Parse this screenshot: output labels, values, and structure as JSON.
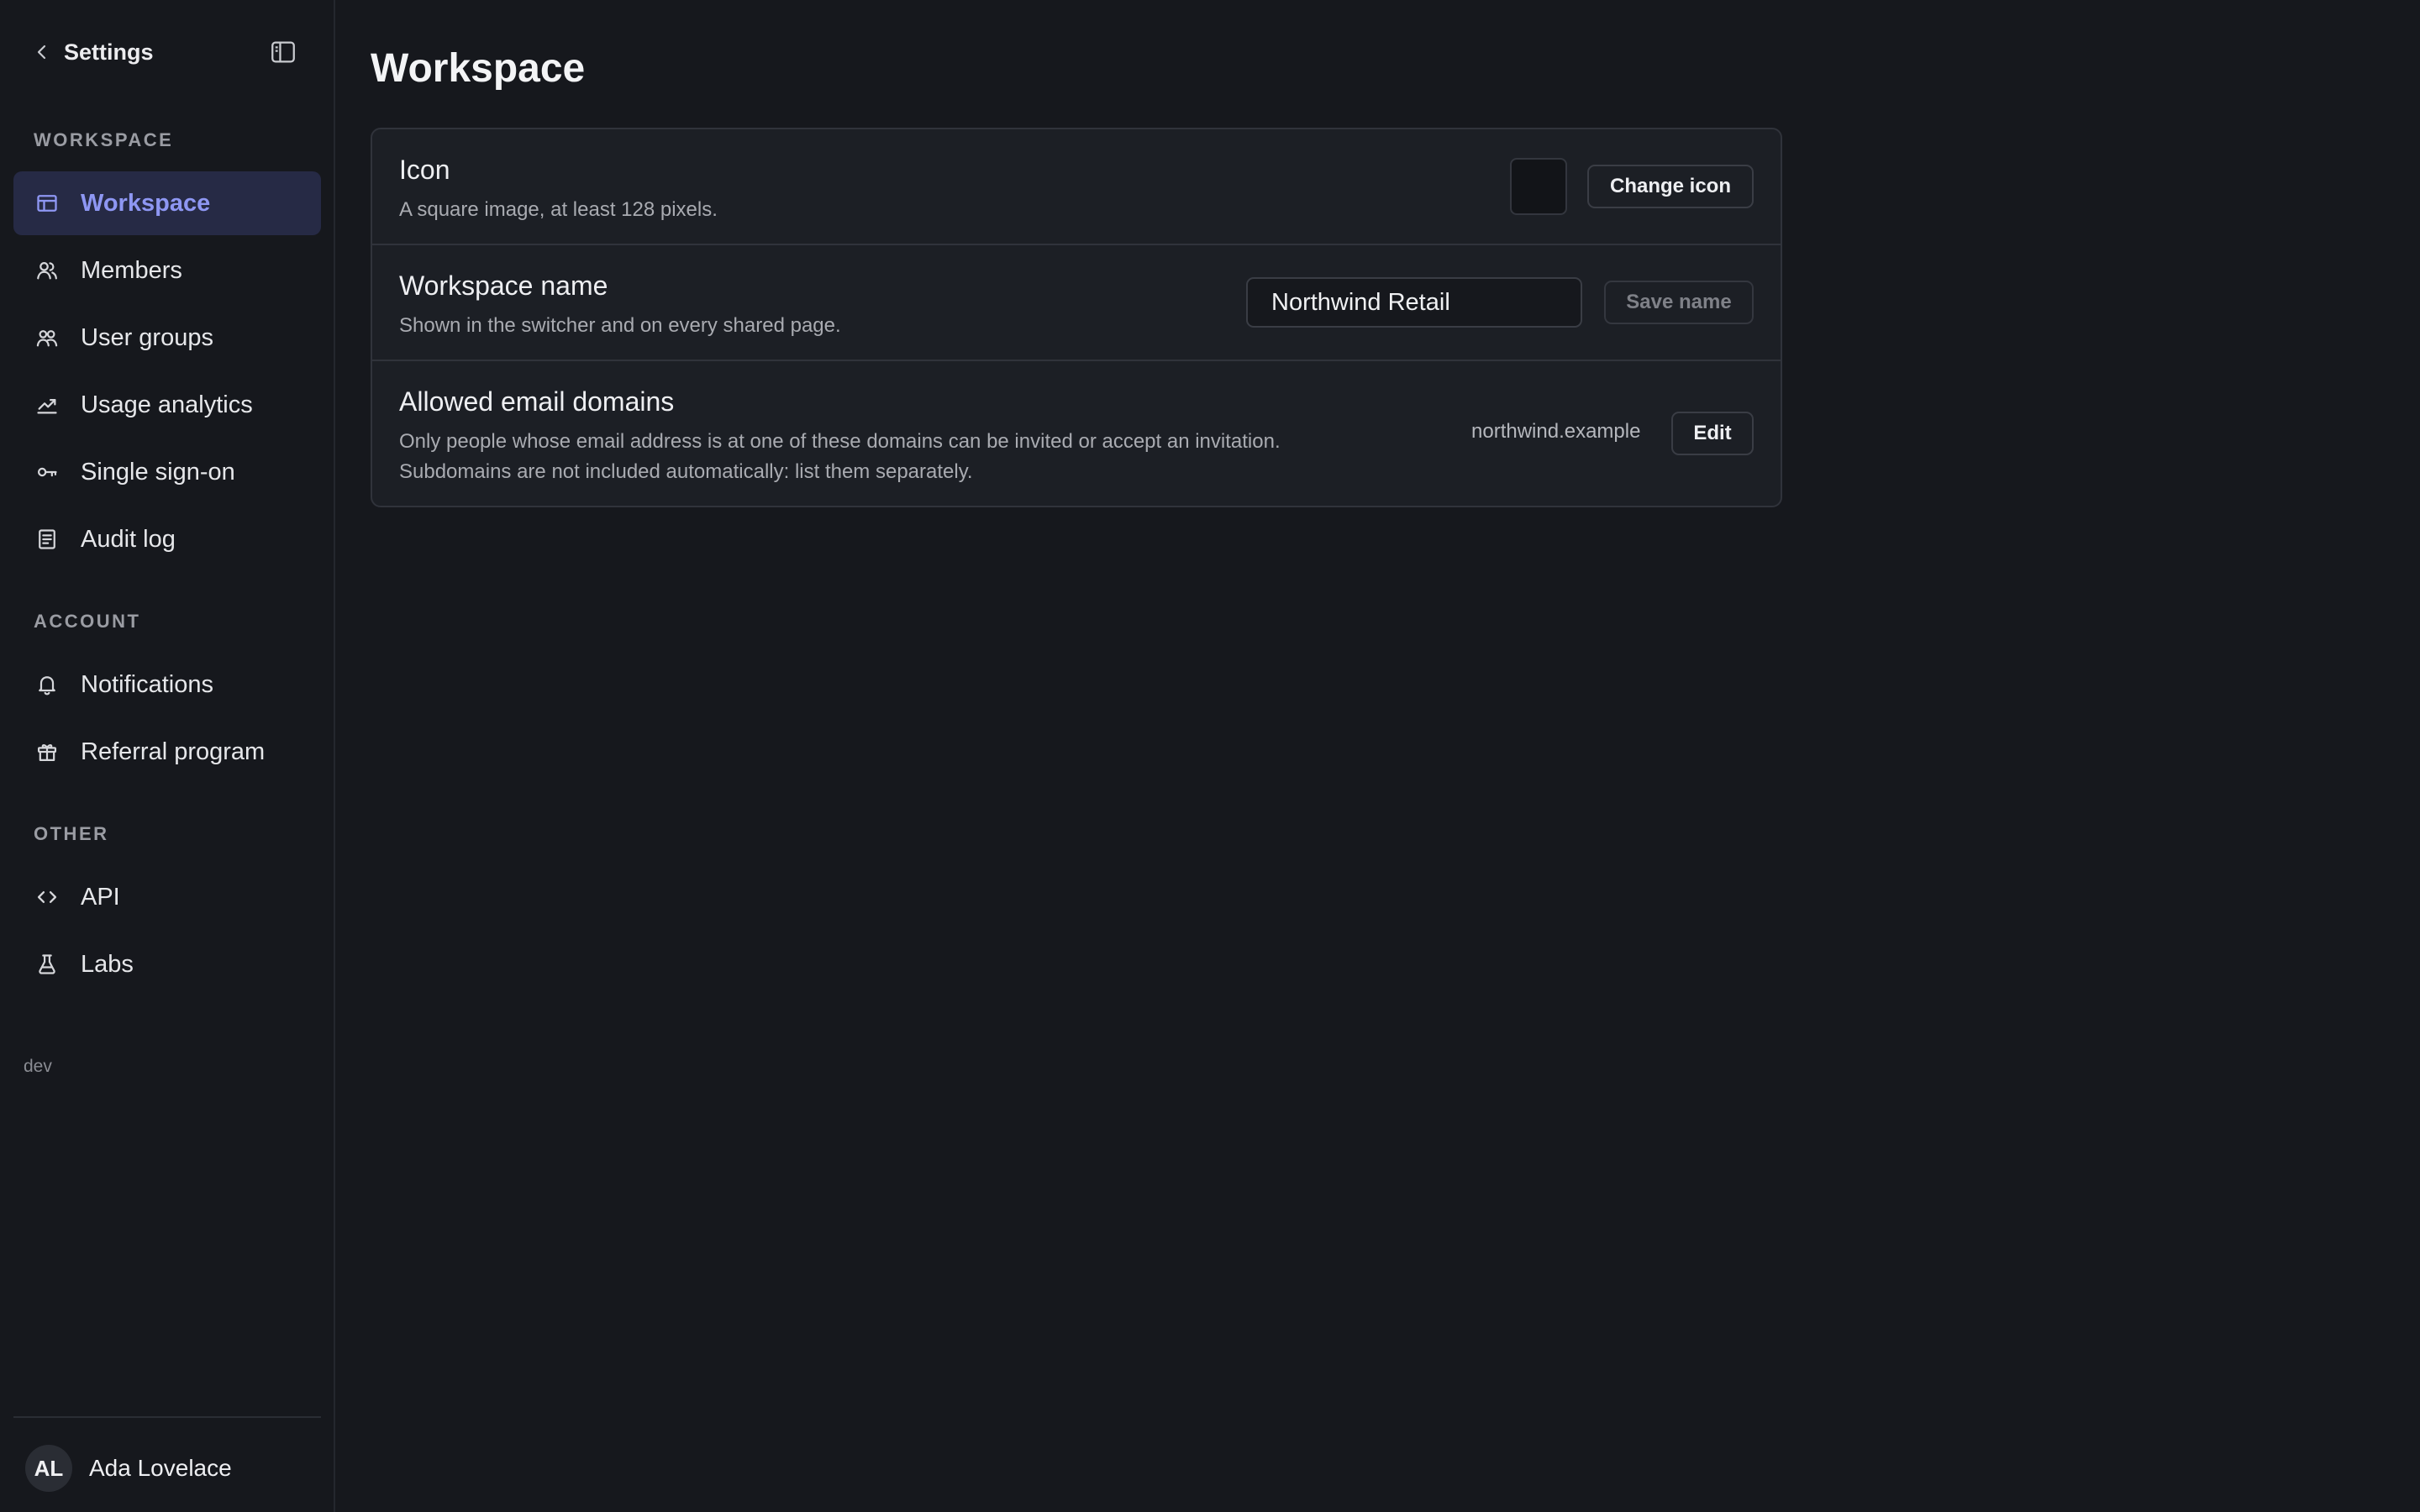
{
  "sidebar": {
    "back_label": "Settings",
    "sections": [
      {
        "label": "WORKSPACE",
        "items": [
          {
            "label": "Workspace",
            "icon": "layout-icon",
            "active": true
          },
          {
            "label": "Members",
            "icon": "members-icon"
          },
          {
            "label": "User groups",
            "icon": "user-groups-icon"
          },
          {
            "label": "Usage analytics",
            "icon": "chart-line-icon"
          },
          {
            "label": "Single sign-on",
            "icon": "key-icon"
          },
          {
            "label": "Audit log",
            "icon": "document-icon"
          }
        ]
      },
      {
        "label": "ACCOUNT",
        "items": [
          {
            "label": "Notifications",
            "icon": "bell-icon"
          },
          {
            "label": "Referral program",
            "icon": "gift-icon"
          }
        ]
      },
      {
        "label": "OTHER",
        "items": [
          {
            "label": "API",
            "icon": "code-icon"
          },
          {
            "label": "Labs",
            "icon": "flask-icon"
          }
        ]
      }
    ],
    "env_label": "dev",
    "user": {
      "initials": "AL",
      "name": "Ada Lovelace"
    }
  },
  "main": {
    "title": "Workspace",
    "icon_row": {
      "title": "Icon",
      "description": "A square image, at least 128 pixels.",
      "button_label": "Change icon"
    },
    "name_row": {
      "title": "Workspace name",
      "description": "Shown in the switcher and on every shared page.",
      "input_value": "Northwind Retail",
      "button_label": "Save name"
    },
    "domains_row": {
      "title": "Allowed email domains",
      "description_line1": "Only people whose email address is at one of these domains can be invited or accept an invitation.",
      "description_line2": "Subdomains are not included automatically: list them separately.",
      "domain_value": "northwind.example",
      "button_label": "Edit"
    }
  },
  "colors": {
    "background": "#16181d",
    "card": "#1c1f25",
    "active_bg": "#262a45",
    "active_text": "#8e97f3"
  }
}
